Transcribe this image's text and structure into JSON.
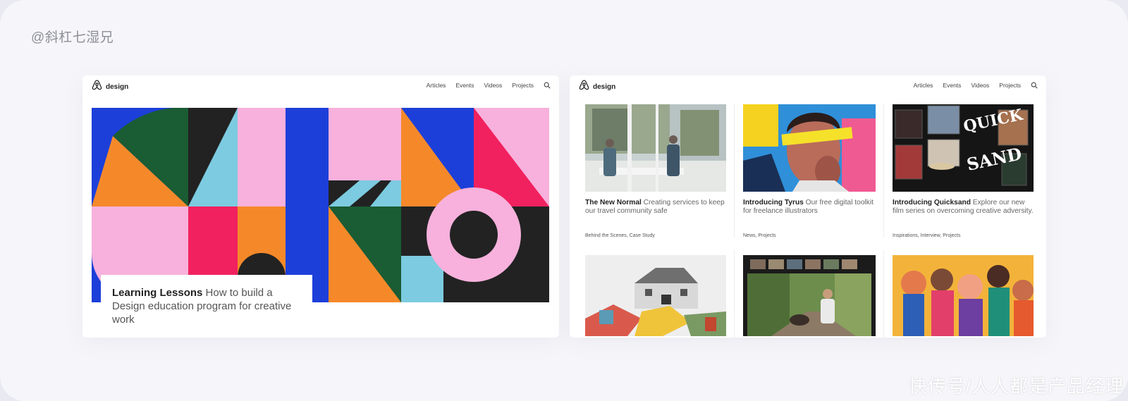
{
  "watermark_top": "@斜杠七湿兄",
  "watermark_bottom": "快传号/人人都是产品经理",
  "left_card": {
    "brand": "design",
    "nav": [
      "Articles",
      "Events",
      "Videos",
      "Projects"
    ],
    "hero": {
      "title_bold": "Learning Lessons",
      "title_rest": " How to build a Design education program for creative work"
    }
  },
  "right_card": {
    "brand": "design",
    "nav": [
      "Articles",
      "Events",
      "Videos",
      "Projects"
    ],
    "tiles": [
      {
        "title_bold": "The New Normal",
        "title_rest": " Creating services to keep our travel community safe",
        "tags": "Behind the Scenes, Case Study"
      },
      {
        "title_bold": "Introducing Tyrus",
        "title_rest": " Our free digital toolkit for freelance illustrators",
        "tags": "News, Projects"
      },
      {
        "title_bold": "Introducing Quicksand",
        "title_rest": " Explore our new film series on overcoming creative adversity.",
        "tags": "Inspirations, Interview, Projects"
      }
    ]
  },
  "colors": {
    "blue": "#1d3fd9",
    "pink": "#f7b1dc",
    "orange": "#f5892a",
    "green": "#1a5c34",
    "cyan": "#7ccbe0",
    "red": "#f1215f",
    "black": "#222222",
    "white": "#ffffff"
  },
  "icons": {
    "brand_logo": "airbnb-belo-icon",
    "search": "search-icon"
  }
}
